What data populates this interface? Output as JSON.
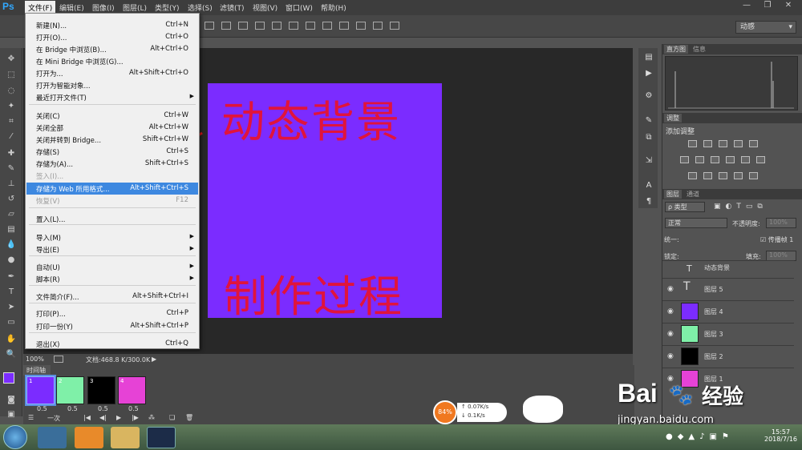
{
  "app": {
    "logo": "Ps"
  },
  "menubar": [
    "文件(F)",
    "编辑(E)",
    "图像(I)",
    "图层(L)",
    "类型(Y)",
    "选择(S)",
    "滤镜(T)",
    "视图(V)",
    "窗口(W)",
    "帮助(H)"
  ],
  "window_controls": [
    "—",
    "❐",
    "✕"
  ],
  "options": {
    "preset": "动感"
  },
  "file_menu": [
    {
      "label": "新建(N)...",
      "shortcut": "Ctrl+N"
    },
    {
      "label": "打开(O)...",
      "shortcut": "Ctrl+O"
    },
    {
      "label": "在 Bridge 中浏览(B)...",
      "shortcut": "Alt+Ctrl+O"
    },
    {
      "label": "在 Mini Bridge 中浏览(G)...",
      "shortcut": ""
    },
    {
      "label": "打开为...",
      "shortcut": "Alt+Shift+Ctrl+O"
    },
    {
      "label": "打开为智能对象...",
      "shortcut": ""
    },
    {
      "label": "最近打开文件(T)",
      "shortcut": ""
    },
    {
      "label": "关闭(C)",
      "shortcut": "Ctrl+W"
    },
    {
      "label": "关闭全部",
      "shortcut": "Alt+Ctrl+W"
    },
    {
      "label": "关闭并转到 Bridge...",
      "shortcut": "Shift+Ctrl+W"
    },
    {
      "label": "存储(S)",
      "shortcut": "Ctrl+S"
    },
    {
      "label": "存储为(A)...",
      "shortcut": "Shift+Ctrl+S"
    },
    {
      "label": "签入(I)...",
      "shortcut": ""
    },
    {
      "label": "存储为 Web 所用格式...",
      "shortcut": "Alt+Shift+Ctrl+S"
    },
    {
      "label": "恢复(V)",
      "shortcut": "F12"
    },
    {
      "label": "置入(L)...",
      "shortcut": ""
    },
    {
      "label": "导入(M)",
      "shortcut": ""
    },
    {
      "label": "导出(E)",
      "shortcut": ""
    },
    {
      "label": "自动(U)",
      "shortcut": ""
    },
    {
      "label": "脚本(R)",
      "shortcut": ""
    },
    {
      "label": "文件简介(F)...",
      "shortcut": "Alt+Shift+Ctrl+I"
    },
    {
      "label": "打印(P)...",
      "shortcut": "Ctrl+P"
    },
    {
      "label": "打印一份(Y)",
      "shortcut": "Alt+Shift+Ctrl+P"
    },
    {
      "label": "退出(X)",
      "shortcut": "Ctrl+Q"
    }
  ],
  "canvas": {
    "top_text": "动态背景",
    "bottom_text": "制作过程",
    "bg": "#7b2cff",
    "text_color": "#e0143c"
  },
  "status": {
    "zoom": "100%",
    "doc": "文档:468.8 K/300.0K"
  },
  "timeline": {
    "tab": "时间轴",
    "frames": [
      {
        "n": "1",
        "delay": "0.5"
      },
      {
        "n": "2",
        "delay": "0.5"
      },
      {
        "n": "3",
        "delay": "0.5"
      },
      {
        "n": "4",
        "delay": "0.5"
      }
    ],
    "loop": "一次"
  },
  "panels": {
    "hist_tabs": [
      "直方图",
      "信息"
    ],
    "adj_tab": "调整",
    "adj_title": "添加调整",
    "layer_tabs": [
      "图层",
      "通道"
    ],
    "kind": "ρ 类型",
    "blend": "正常",
    "opacity_label": "不透明度:",
    "opacity": "100%",
    "unify": "统一:",
    "propagate": "传播帧 1",
    "lock": "锁定:",
    "fill_label": "填充:",
    "fill": "100%",
    "layers": [
      {
        "name": "动态背景"
      },
      {
        "name": "图层 5"
      },
      {
        "name": "图层 4"
      },
      {
        "name": "图层 3"
      },
      {
        "name": "图层 2"
      },
      {
        "name": "图层 1"
      }
    ]
  },
  "speed": {
    "pct": "84%",
    "up": "0.07K/s",
    "down": "0.1K/s"
  },
  "watermark": {
    "brand": "Bai",
    "brand2": "经验",
    "url": "jingyan.baidu.com"
  },
  "clock": {
    "time": "15:57",
    "date": "2018/7/16"
  },
  "colors": {
    "highlight": "#3d88e0",
    "arrow": "#e0141c"
  }
}
